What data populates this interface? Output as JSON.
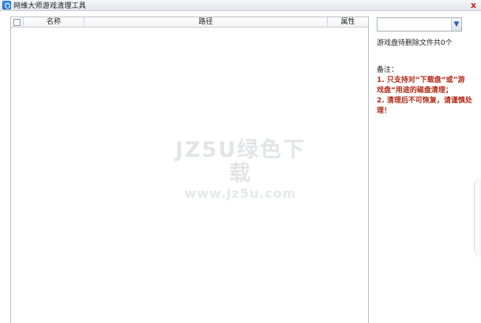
{
  "window": {
    "title": "网维大师游戏清理工具",
    "close_glyph": "x",
    "icon": "app-logo-icon"
  },
  "list": {
    "columns": {
      "name": "名称",
      "path": "路径",
      "attr": "属性"
    },
    "rows": []
  },
  "side": {
    "drive_select_value": "",
    "count_text": "游戏盘待删除文件共0个",
    "notes_title": "备注：",
    "notes": [
      "1. 只支持对“下载盘“或”游",
      "戏盘“用途的磁盘清理；",
      "2. 清理后不可恢复，请谨慎处理！"
    ]
  },
  "watermark": {
    "line1": "JZ5U绿色下载",
    "line2": "www.jz5u.com"
  },
  "colors": {
    "note_red": "#b12a17",
    "close_red": "#d81e1e",
    "accent_blue": "#1f6fd6"
  }
}
